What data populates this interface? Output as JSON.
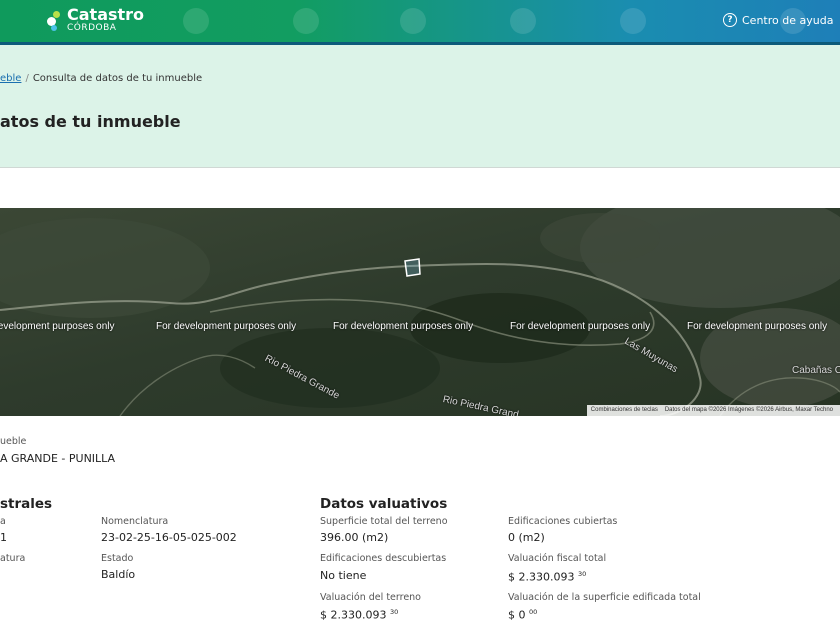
{
  "header": {
    "brand_title": "Catastro",
    "brand_subtitle": "CÓRDOBA",
    "help_label": "Centro de ayuda",
    "help_icon": "question-circle-icon"
  },
  "breadcrumb": {
    "link": "eble",
    "separator": "/",
    "current": "Consulta de datos de tu inmueble"
  },
  "page": {
    "title": "atos de tu inmueble"
  },
  "map": {
    "watermark": "For development purposes only",
    "watermark_first": "elevelopment purposes only",
    "labels": [
      "Rio Piedra Grande",
      "Rio Piedra Grand",
      "Las Muyunas",
      "Cabañas Ca"
    ],
    "attribution": [
      "Combinaciones de teclas",
      "Datos del mapa ©2026 Imágenes ©2026 Airbus, Maxar Techno"
    ]
  },
  "location": {
    "label": "ueble",
    "value": "A GRANDE - PUNILLA"
  },
  "catastrales": {
    "title": "strales",
    "col1": [
      {
        "label": "a",
        "value": "1"
      },
      {
        "label": "atura",
        "value": ""
      }
    ],
    "col2": [
      {
        "label": "Nomenclatura",
        "value": "23-02-25-16-05-025-002"
      },
      {
        "label": "Estado",
        "value": "Baldío"
      }
    ]
  },
  "valuativos": {
    "title": "Datos valuativos",
    "items": [
      {
        "label": "Superficie total del terreno",
        "value": "396.00 (m2)"
      },
      {
        "label": "Edificaciones cubiertas",
        "value": "0 (m2)"
      },
      {
        "label": "Edificaciones descubiertas",
        "value": "No tiene"
      },
      {
        "label": "Valuación fiscal total",
        "value": "$ 2.330.093",
        "cents": "30"
      },
      {
        "label": "Valuación del terreno",
        "value": "$ 2.330.093",
        "cents": "30"
      },
      {
        "label": "Valuación de la superficie edificada total",
        "value": "$ 0",
        "cents": "00"
      }
    ]
  }
}
